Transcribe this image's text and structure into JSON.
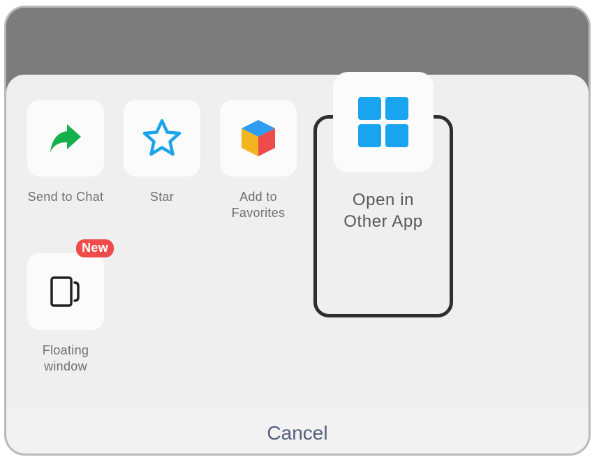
{
  "actions": [
    {
      "label": "Send to Chat",
      "icon": "share-arrow-icon",
      "color": "#14b04b"
    },
    {
      "label": "Star",
      "icon": "star-outline-icon",
      "color": "#1aa3ee"
    },
    {
      "label": "Add to\nFavorites",
      "icon": "cube-icon",
      "colors": [
        "#2d9cf1",
        "#f3b51f",
        "#ee4b4b"
      ]
    },
    {
      "label": "Open in\nOther App",
      "icon": "grid-tiles-icon",
      "color": "#1aa3ee"
    }
  ],
  "second_row": [
    {
      "label": "Floating\nwindow",
      "icon": "floating-window-icon",
      "badge": "New",
      "badge_color": "#ee4b4b"
    }
  ],
  "cancel_label": "Cancel"
}
